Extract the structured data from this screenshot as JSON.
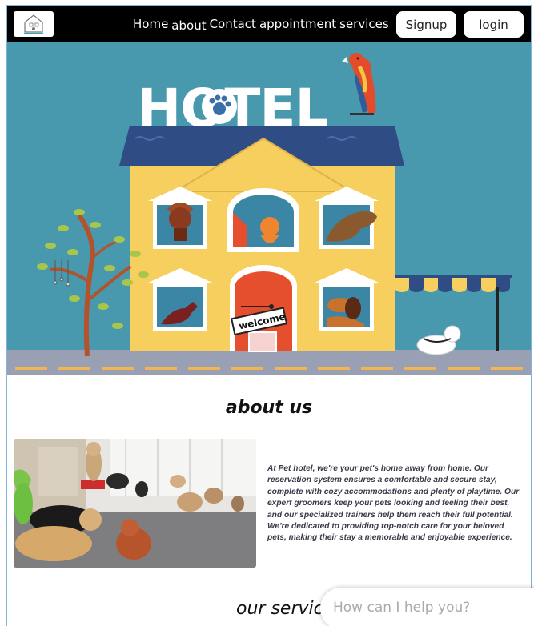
{
  "nav": {
    "logo_icon": "pet-hotel-logo",
    "links": [
      "Home",
      "about",
      "Contact",
      "appointment",
      "services"
    ],
    "signup_label": "Signup",
    "login_label": "login"
  },
  "hero": {
    "sign_text": "HOTEL",
    "welcome_text": "welcome",
    "sky_color": "#4899ad"
  },
  "about": {
    "title": "about us",
    "text": "At Pet hotel, we're your pet's home away from home. Our reservation system ensures a comfortable and secure stay, complete with cozy accommodations and plenty of playtime. Our expert groomers keep your pets looking and feeling their best, and our specialized trainers help them reach their full potential. We're dedicated to providing top-notch care for your beloved pets, making their stay a memorable and enjoyable experience."
  },
  "services": {
    "title": "our service"
  },
  "chat": {
    "placeholder": "How can I help you?"
  }
}
